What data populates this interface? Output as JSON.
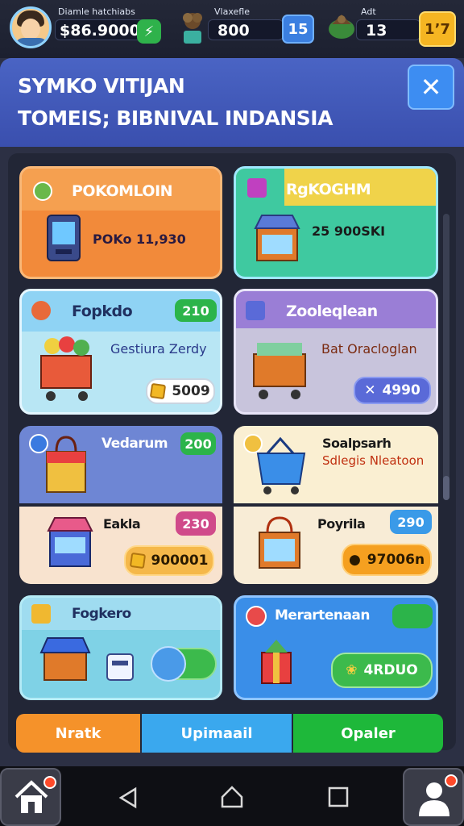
{
  "topbar": {
    "player_name": "Diamle hatchiabs",
    "coins": "$86.9000",
    "stat2_label": "Vlaxefle",
    "stat2_value": "800",
    "stat2_badge": "15",
    "stat3_label": "Adt",
    "stat3_value": "13",
    "stat3_badge": "1ʼ7"
  },
  "header": {
    "line1": "SYMKO VITIJAN",
    "line2": "TOMEIS; BIBNIVAL INDANSIA",
    "close_label": "✕"
  },
  "cards": [
    {
      "title": "POKOMLOIN",
      "desc": "POKo 11,930",
      "bg": "#f28a3a",
      "header_bg": "#f5a050"
    },
    {
      "title": "RgKOGHM",
      "desc": "25 900SKI",
      "bg": "#3fc9a0",
      "header_bg": "#f0d34a"
    },
    {
      "title": "Fopkdo",
      "desc": "Gestiura Zerdy",
      "badge": "210",
      "price": "5009",
      "bg": "#b8e6f4",
      "header_bg": "#8fd3f4"
    },
    {
      "title": "Zooleqlean",
      "desc": "Bat Oracloglan",
      "price": "4990",
      "bg": "#c8c4dc",
      "header_bg": "#9a7ed6"
    },
    {
      "title": "Vedarum",
      "badge": "200",
      "bg": "#6e86d4"
    },
    {
      "title": "Soalpsarh",
      "desc": "Sdlegis Nleatoon",
      "bg": "#faefd2"
    },
    {
      "title": "Eakla",
      "badge": "230",
      "price": "900001",
      "bg": "#f8e3cf"
    },
    {
      "title": "Poyrila",
      "badge": "290",
      "price": "97006n",
      "bg": "#f8ecd6"
    },
    {
      "title": "Fogkero",
      "bg": "#7fd2e6"
    },
    {
      "title": "Merartenaan",
      "price": "4RDUO",
      "bg": "#3a8ee8"
    }
  ],
  "bottom_buttons": [
    "Nratk",
    "Upimaail",
    "Opaler"
  ],
  "colors": {
    "accent_blue": "#3d8df2",
    "accent_green": "#2fb24b",
    "accent_orange": "#f28a3a",
    "gold": "#f5b522"
  }
}
